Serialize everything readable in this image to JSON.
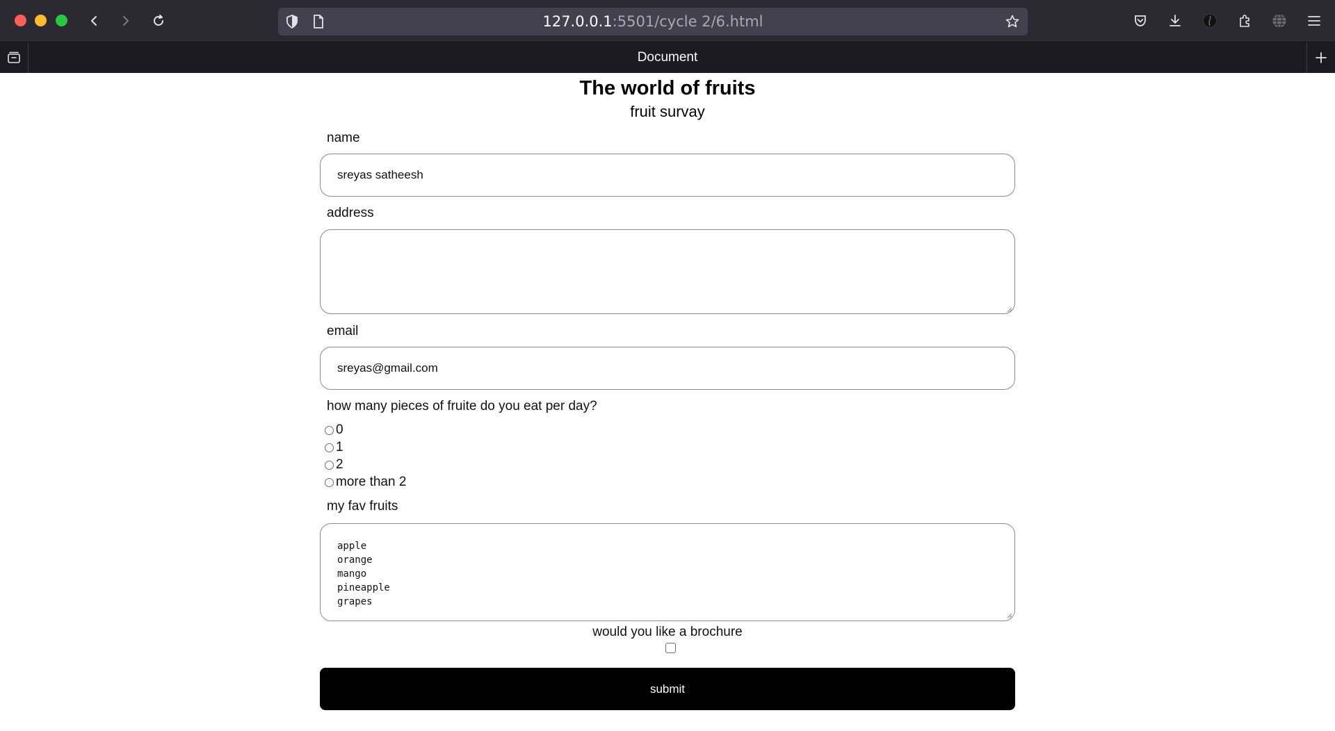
{
  "browser": {
    "url_host": "127.0.0.1",
    "url_path": ":5501/cycle 2/6.html",
    "tab_title": "Document",
    "icons": [
      "back-icon",
      "forward-icon",
      "reload-icon",
      "shield-icon",
      "page-icon",
      "star-icon",
      "pocket-icon",
      "download-icon",
      "profile-icon",
      "extensions-icon",
      "globe-icon",
      "menu-icon",
      "tab-overview-icon",
      "new-tab-icon"
    ]
  },
  "page": {
    "title": "The world of fruits",
    "subtitle": "fruit survay",
    "name_label": "name",
    "name_value": "sreyas satheesh",
    "address_label": "address",
    "address_value": "",
    "email_label": "email",
    "email_value": "sreyas@gmail.com",
    "question": "how many pieces of fruite do you eat per day?",
    "options": [
      "0",
      "1",
      "2",
      "more than 2"
    ],
    "fav_label": "my fav fruits",
    "fav_lines": [
      "apple",
      "orange",
      "mango",
      "pineapple",
      "grapes"
    ],
    "brochure_label": "would you like a brochure",
    "submit_label": "submit"
  }
}
